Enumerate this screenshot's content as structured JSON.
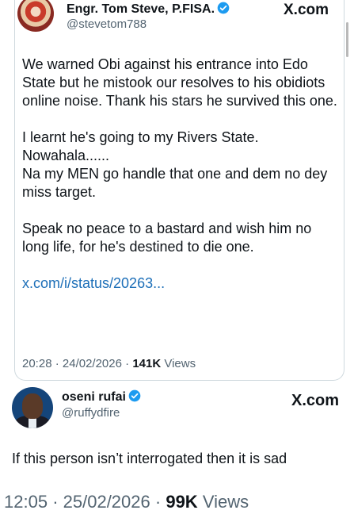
{
  "quoted_post": {
    "author_name": "Engr. Tom Steve, P.FISA.",
    "author_handle": "@stevetom788",
    "brand": "X.com",
    "paragraphs": [
      "We warned Obi against his entrance into Edo State but he mistook our resolves to his obidiots online noise. Thank his stars he survived this one.",
      "I learnt he's going to my Rivers State.\nNowahala......\nNa my MEN go handle that one and dem no dey miss target.",
      "Speak no peace to a bastard and wish him no long life, for he's destined to die one."
    ],
    "link": "x.com/i/status/20263...",
    "time": "20:28",
    "date": "24/02/2026",
    "views_count": "141K",
    "views_label": "Views"
  },
  "main_post": {
    "author_name": "oseni rufai",
    "author_handle": "@ruffydfire",
    "brand": "X.com",
    "text": "If this person isn’t interrogated then it is sad",
    "time": "12:05",
    "date": "25/02/2026",
    "views_count": "99K",
    "views_label": "Views"
  },
  "colors": {
    "verified": "#1d9bf0",
    "link": "#1d6fb8",
    "secondary_text": "#536471",
    "border": "#cfd9de"
  },
  "icons": [
    "verified-badge-icon",
    "x-logo"
  ]
}
